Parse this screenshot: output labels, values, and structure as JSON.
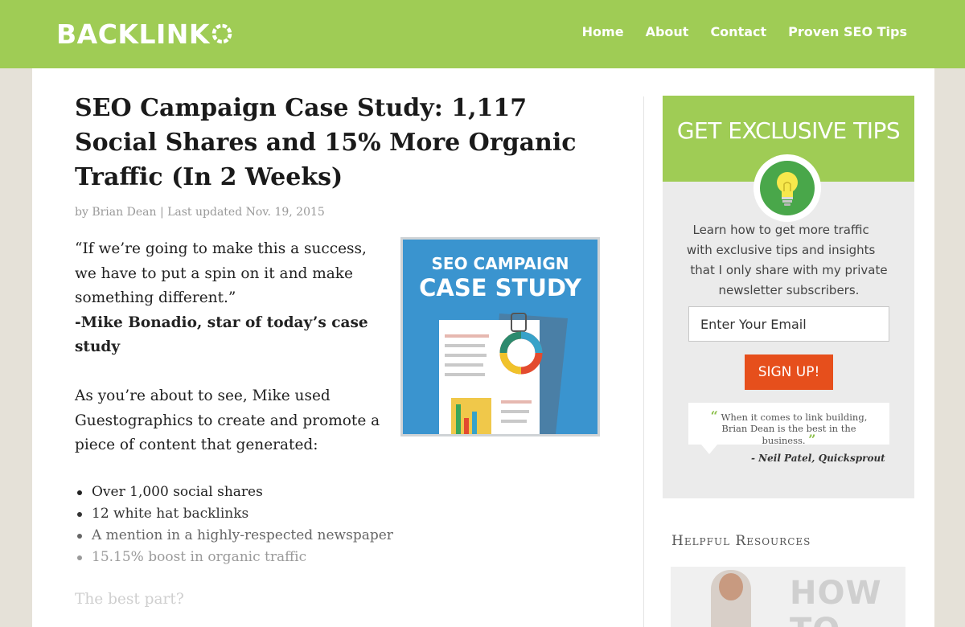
{
  "brand": {
    "logo_text": "BACKLINK",
    "accent": "#9fcc55"
  },
  "nav": {
    "items": [
      "Home",
      "About",
      "Contact",
      "Proven SEO Tips"
    ]
  },
  "article": {
    "title": "SEO Campaign Case Study: 1,117 Social Shares and 15% More Organic Traffic (In 2 Weeks)",
    "byline_prefix": "by",
    "author": "Brian Dean",
    "updated": "| Last updated Nov. 19, 2015",
    "quote": "“If we’re going to make this a success, we have to put a spin on it and make something different.”",
    "quote_by": "-Mike Bonadio, star of today’s case study",
    "para2": "As you’re about to see, Mike used Guestographics to create and promote a piece of content that generated:",
    "bullets": [
      "Over 1,000 social shares",
      "12 white hat backlinks",
      "A mention in a highly-respected newspaper",
      "15.15% boost in organic traffic"
    ],
    "best_part": "The best part?",
    "image": {
      "line1": "SEO CAMPAIGN",
      "line2": "CASE STUDY"
    }
  },
  "sidebar": {
    "widget": {
      "title": "GET EXCLUSIVE TIPS",
      "icon": "lightbulb-icon",
      "text": "Learn how to get more traffic  with exclusive tips and insights  that I only share with my private newsletter subscribers.",
      "email_placeholder": "Enter Your Email",
      "button_label": "SIGN UP!",
      "button_color": "#e64f1c",
      "testimonial_open": "“",
      "testimonial": "When it comes to link building, Brian Dean is the best in the business.",
      "testimonial_close": "”",
      "testimonial_author": "- Neil Patel, Quicksprout"
    },
    "resources": {
      "title": "Helpful Resources",
      "image_text": "HOW TO"
    }
  }
}
